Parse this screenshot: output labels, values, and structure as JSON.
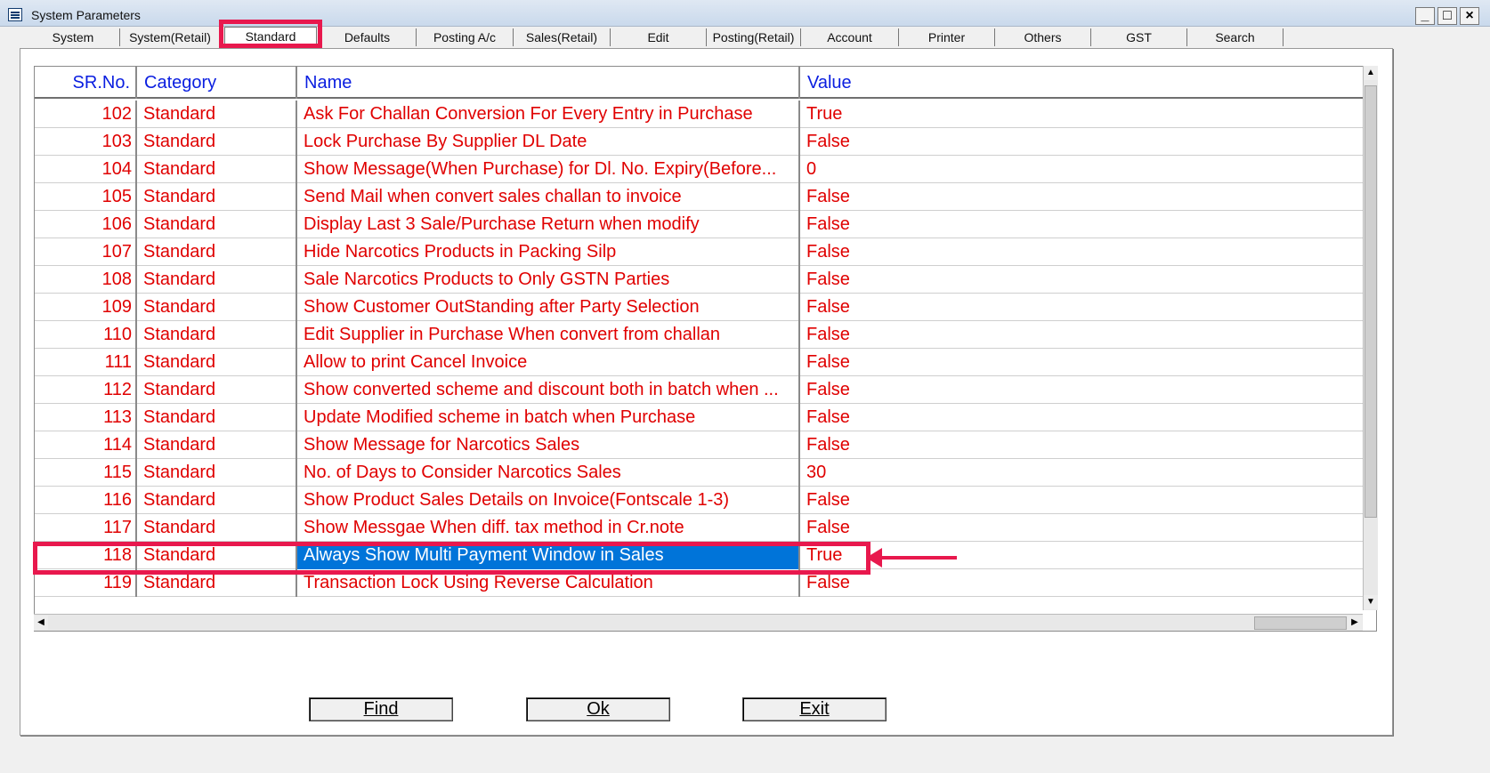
{
  "window": {
    "title": "System Parameters",
    "minimize": "_",
    "maximize": "□",
    "close": "×"
  },
  "tabs": [
    "System",
    "System(Retail)",
    "Standard",
    "Defaults",
    "Posting A/c",
    "Sales(Retail)",
    "Edit",
    "Posting(Retail)",
    "Account",
    "Printer",
    "Others",
    "GST",
    "Search"
  ],
  "active_tab": "Standard",
  "table": {
    "columns": [
      "SR.No.",
      "Category",
      "Name",
      "Value"
    ],
    "rows": [
      {
        "sr": "102",
        "category": "Standard",
        "name": "Ask For Challan Conversion For Every Entry in Purchase",
        "value": "True"
      },
      {
        "sr": "103",
        "category": "Standard",
        "name": "Lock Purchase By Supplier DL Date",
        "value": "False"
      },
      {
        "sr": "104",
        "category": "Standard",
        "name": "Show Message(When Purchase) for Dl. No. Expiry(Before...",
        "value": "0"
      },
      {
        "sr": "105",
        "category": "Standard",
        "name": "Send Mail when convert sales challan to invoice",
        "value": "False"
      },
      {
        "sr": "106",
        "category": "Standard",
        "name": "Display Last 3 Sale/Purchase Return when modify",
        "value": "False"
      },
      {
        "sr": "107",
        "category": "Standard",
        "name": "Hide Narcotics Products in Packing Silp",
        "value": "False"
      },
      {
        "sr": "108",
        "category": "Standard",
        "name": "Sale Narcotics Products to Only GSTN Parties",
        "value": "False"
      },
      {
        "sr": "109",
        "category": "Standard",
        "name": "Show Customer OutStanding after Party Selection",
        "value": "False"
      },
      {
        "sr": "110",
        "category": "Standard",
        "name": "Edit Supplier in Purchase When convert from challan",
        "value": "False"
      },
      {
        "sr": "111",
        "category": "Standard",
        "name": "Allow to print Cancel Invoice",
        "value": "False"
      },
      {
        "sr": "112",
        "category": "Standard",
        "name": "Show converted scheme and discount both in batch when ...",
        "value": "False"
      },
      {
        "sr": "113",
        "category": "Standard",
        "name": "Update Modified scheme in batch when Purchase",
        "value": "False"
      },
      {
        "sr": "114",
        "category": "Standard",
        "name": "Show Message for Narcotics Sales",
        "value": "False"
      },
      {
        "sr": "115",
        "category": "Standard",
        "name": "No. of Days to Consider Narcotics Sales",
        "value": "30"
      },
      {
        "sr": "116",
        "category": "Standard",
        "name": "Show Product Sales Details on Invoice(Fontscale 1-3)",
        "value": "False"
      },
      {
        "sr": "117",
        "category": "Standard",
        "name": "Show Messgae When diff. tax method in Cr.note",
        "value": "False"
      },
      {
        "sr": "118",
        "category": "Standard",
        "name": "Always Show Multi Payment Window in Sales",
        "value": "True"
      },
      {
        "sr": "119",
        "category": "Standard",
        "name": "Transaction Lock Using Reverse Calculation",
        "value": "False"
      }
    ],
    "selected_sr": "118"
  },
  "buttons": {
    "find": "Find",
    "ok": "Ok",
    "exit": "Exit"
  },
  "colors": {
    "row_text": "#e00000",
    "header_text": "#0a1ee0",
    "selection": "#0074d9",
    "highlight": "#e8184d"
  }
}
